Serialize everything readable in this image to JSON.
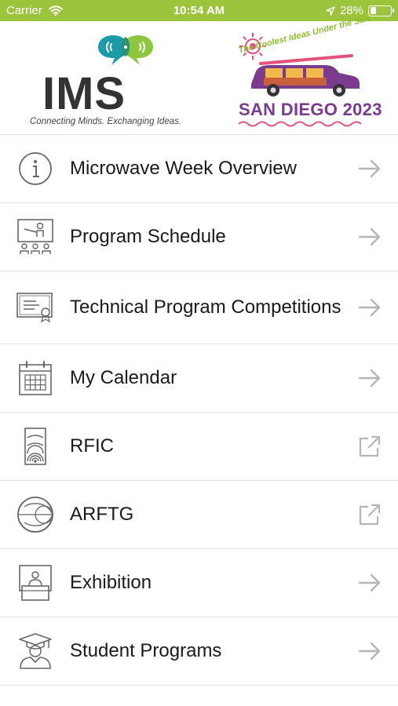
{
  "status_bar": {
    "carrier": "Carrier",
    "time": "10:54 AM",
    "battery_percent": "28%",
    "battery_level": 0.28,
    "background_color": "#9bc33b",
    "wifi_icon": "wifi-icon",
    "location_icon": "location-arrow-icon"
  },
  "header": {
    "ims_logo": {
      "wordmark": "IMS",
      "tagline": "Connecting Minds. Exchanging Ideas."
    },
    "event_logo": {
      "tagline": "The Coolest Ideas Under the Sun",
      "city": "SAN DIEGO",
      "year": "2023"
    }
  },
  "menu": {
    "items": [
      {
        "label": "Microwave Week Overview",
        "icon": "info-circle-icon",
        "action_icon": "arrow-right-icon"
      },
      {
        "label": "Program Schedule",
        "icon": "presentation-icon",
        "action_icon": "arrow-right-icon"
      },
      {
        "label": "Technical Program Competitions",
        "icon": "certificate-icon",
        "action_icon": "arrow-right-icon"
      },
      {
        "label": "My Calendar",
        "icon": "calendar-icon",
        "action_icon": "arrow-right-icon"
      },
      {
        "label": "RFIC",
        "icon": "rfic-chip-icon",
        "action_icon": "external-link-icon"
      },
      {
        "label": "ARFTG",
        "icon": "smith-chart-icon",
        "action_icon": "external-link-icon"
      },
      {
        "label": "Exhibition",
        "icon": "exhibition-booth-icon",
        "action_icon": "arrow-right-icon"
      },
      {
        "label": "Student Programs",
        "icon": "graduate-icon",
        "action_icon": "arrow-right-icon"
      }
    ]
  },
  "colors": {
    "accent_green": "#9bc33b",
    "icon_gray": "#666666",
    "chevron_gray": "#b5b5b5",
    "event_purple": "#7a3a8e",
    "ims_teal": "#1c9aa8",
    "ims_green": "#8dc63f"
  }
}
